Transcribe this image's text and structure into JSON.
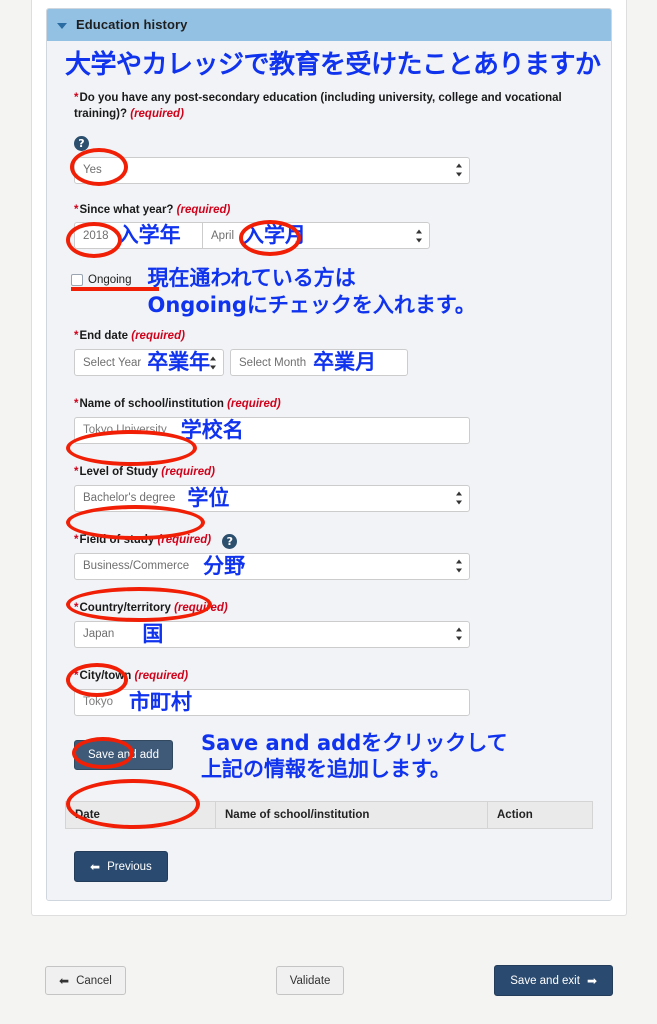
{
  "panel": {
    "title": "Education history",
    "caret_icon": "chevron-down-icon"
  },
  "annotations": {
    "heading": "大学やカレッジで教育を受けたことありますか",
    "since_year": "入学年",
    "since_month": "入学月",
    "ongoing_line1": "現在通われている方は",
    "ongoing_line2": "Ongoingにチェックを入れます。",
    "end_year": "卒業年",
    "end_month": "卒業月",
    "school_name": "学校名",
    "level_of_study": "学位",
    "field_of_study": "分野",
    "country": "国",
    "city": "市町村",
    "save_add_line1": "Save and addをクリックして",
    "save_add_line2": "上記の情報を追加します。"
  },
  "fields": {
    "post_secondary": {
      "asterisk": "*",
      "label": "Do you have any post-secondary education (including university, college and vocational training)?",
      "required": "(required)",
      "help_icon": "help-circle-icon",
      "value": "Yes"
    },
    "since_year": {
      "asterisk": "*",
      "label": "Since what year?",
      "required": "(required)",
      "year_value": "2018",
      "month_value": "April"
    },
    "ongoing": {
      "label": "Ongoing",
      "checked": false
    },
    "end_date": {
      "asterisk": "*",
      "label": "End date",
      "required": "(required)",
      "year_placeholder": "Select Year",
      "month_placeholder": "Select Month"
    },
    "school": {
      "asterisk": "*",
      "label": "Name of school/institution",
      "required": "(required)",
      "value": "Tokyo University"
    },
    "level": {
      "asterisk": "*",
      "label": "Level of Study",
      "required": "(required)",
      "value": "Bachelor's degree"
    },
    "field_of_study": {
      "asterisk": "*",
      "label": "Field of study",
      "required": "(required)",
      "help_icon": "help-circle-icon",
      "value": "Business/Commerce"
    },
    "country": {
      "asterisk": "*",
      "label": "Country/territory",
      "required": "(required)",
      "value": "Japan"
    },
    "city": {
      "asterisk": "*",
      "label": "City/town",
      "required": "(required)",
      "value": "Tokyo"
    }
  },
  "buttons": {
    "save_and_add": "Save and add",
    "previous": "Previous",
    "cancel": "Cancel",
    "validate": "Validate",
    "save_and_exit": "Save and exit",
    "arrow_left_icon": "arrow-left-icon",
    "arrow_right_icon": "arrow-right-icon"
  },
  "table": {
    "columns": [
      "Date",
      "Name of school/institution",
      "Action"
    ],
    "rows": []
  },
  "colors": {
    "panel_header": "#92c1e4",
    "panel_body": "#f1f3f6",
    "annotation_blue": "#1033ee",
    "marker_red": "#f01f06",
    "button_navy": "#2b4a6f",
    "required_red": "#d0021b"
  }
}
